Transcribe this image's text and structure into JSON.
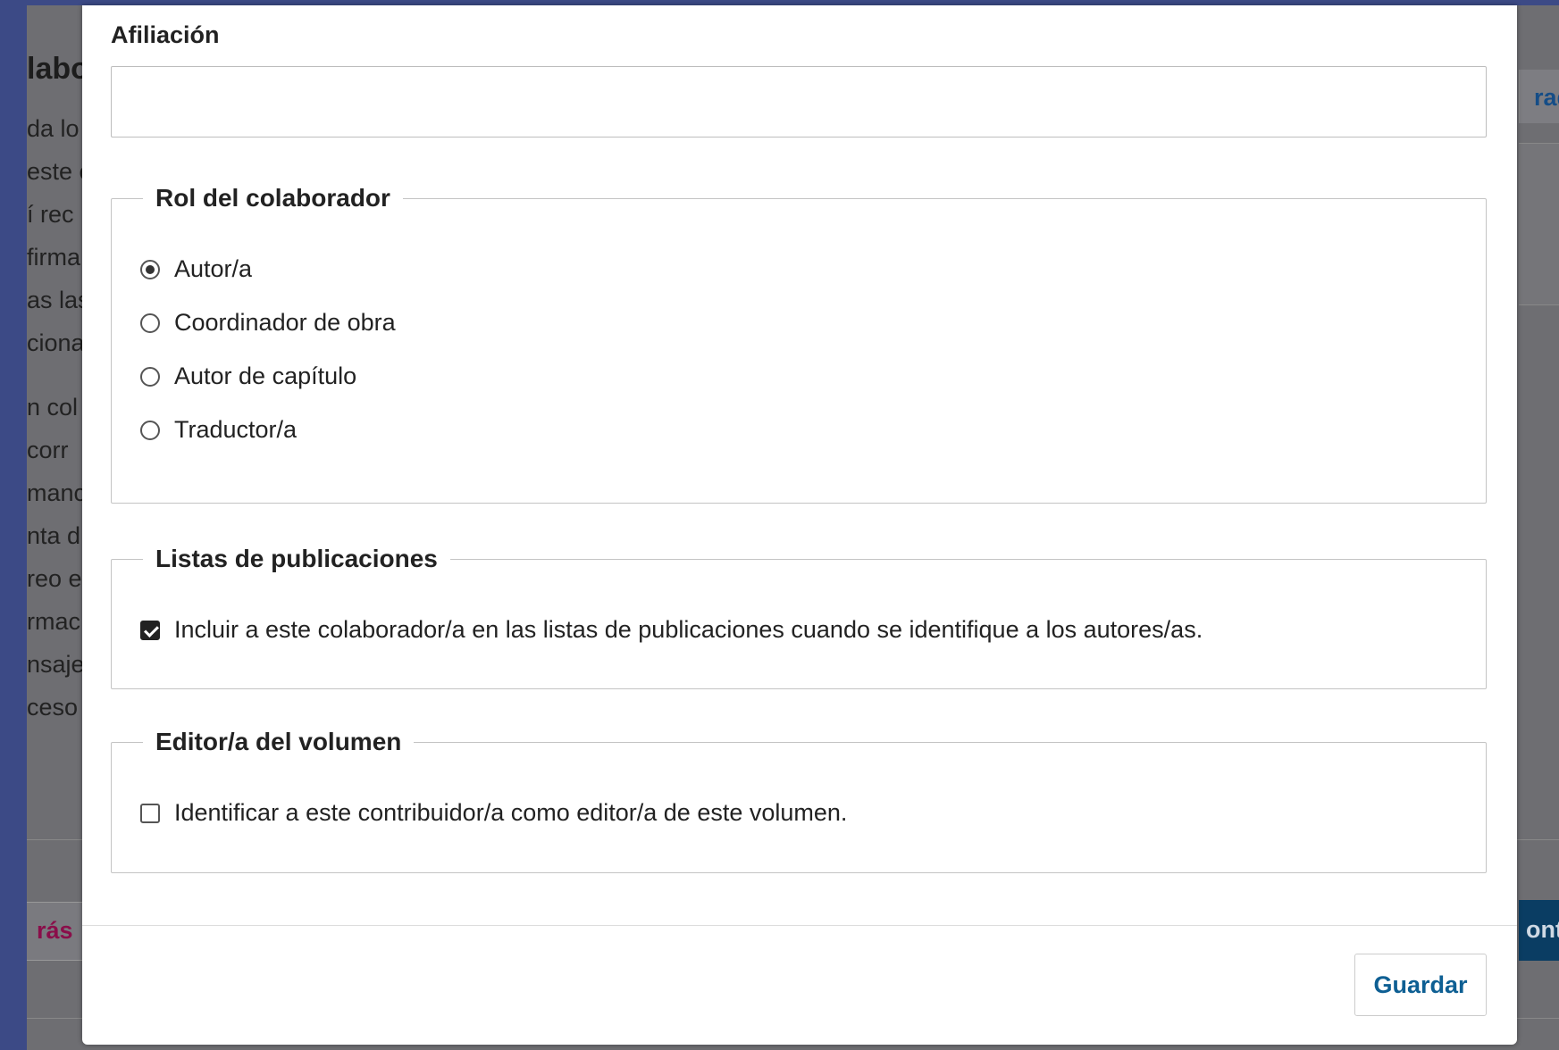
{
  "background": {
    "title_fragment": "labo",
    "text_lines": [
      "da lo",
      "este e",
      "í rec",
      "firma",
      "as las",
      "ciona",
      "",
      "n col",
      "corr",
      "manc",
      "nta d",
      "reo e",
      "rmac",
      "nsaje",
      "ceso"
    ],
    "right_tab": "rad",
    "back_button": "rás",
    "continue_button": "ont"
  },
  "modal": {
    "affiliation": {
      "label": "Afiliación",
      "value": "",
      "placeholder": ""
    },
    "role": {
      "legend": "Rol del colaborador",
      "options": [
        {
          "label": "Autor/a",
          "checked": true
        },
        {
          "label": "Coordinador de obra",
          "checked": false
        },
        {
          "label": "Autor de capítulo",
          "checked": false
        },
        {
          "label": "Traductor/a",
          "checked": false
        }
      ]
    },
    "lists": {
      "legend": "Listas de publicaciones",
      "checkbox_label": "Incluir a este colaborador/a en las listas de publicaciones cuando se identifique a los autores/as.",
      "checked": true
    },
    "volume_editor": {
      "legend": "Editor/a del volumen",
      "checkbox_label": "Identificar a este contribuidor/a como editor/a de este volumen.",
      "checked": false
    },
    "save_label": "Guardar"
  }
}
